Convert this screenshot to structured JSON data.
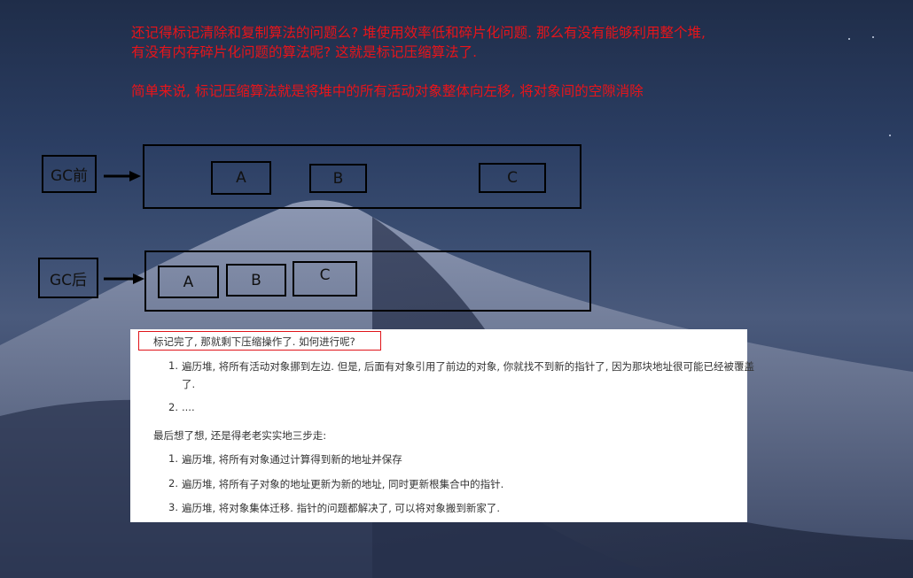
{
  "intro": {
    "line1": "还记得标记清除和复制算法的问题么? 堆使用效率低和碎片化问题. 那么有没有能够利用整个堆,",
    "line2": "有没有内存碎片化问题的算法呢? 这就是标记压缩算法了.",
    "line3": "简单来说, 标记压缩算法就是将堆中的所有活动对象整体向左移, 将对象间的空隙消除"
  },
  "diagram": {
    "before_label": "GC前",
    "after_label": "GC后",
    "before_objects": [
      "A",
      "B",
      "C"
    ],
    "after_objects": [
      "A",
      "B",
      "C"
    ]
  },
  "panel": {
    "highlight_text": "标记完了, 那就剩下压缩操作了. 如何进行呢?",
    "first_list": [
      {
        "num": "1.",
        "text_line1": "遍历堆, 将所有活动对象挪到左边. 但是, 后面有对象引用了前边的对象, 你就找不到新的指针了, 因为那块地址很可能已经被覆盖",
        "text_line2": "了."
      },
      {
        "num": "2.",
        "text_line1": "....",
        "text_line2": ""
      }
    ],
    "summary": "最后想了想, 还是得老老实实地三步走:",
    "second_list": [
      {
        "num": "1.",
        "text": "遍历堆, 将所有对象通过计算得到新的地址并保存"
      },
      {
        "num": "2.",
        "text": "遍历堆, 将所有子对象的地址更新为新的地址, 同时更新根集合中的指针."
      },
      {
        "num": "3.",
        "text": "遍历堆, 将对象集体迁移. 指针的问题都解决了, 可以将对象搬到新家了."
      }
    ]
  }
}
